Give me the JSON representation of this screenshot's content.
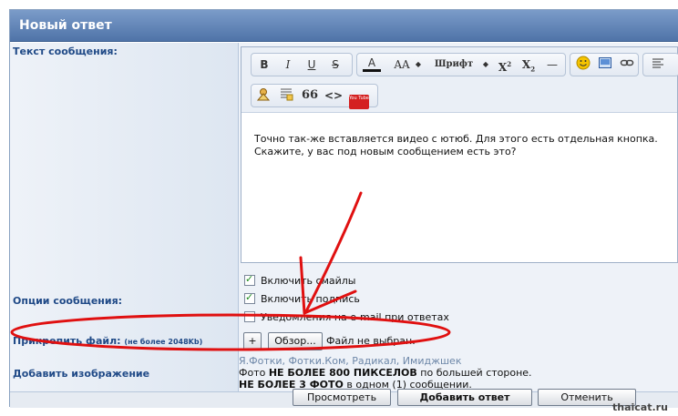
{
  "window": {
    "title": "Новый ответ"
  },
  "labels": {
    "message_text": "Текст сообщения:",
    "message_options": "Опции сообщения:",
    "attach_file": "Прикрепить файл:",
    "attach_limit": "(не более 2048Kb)",
    "add_image": "Добавить изображение"
  },
  "toolbar": {
    "bold": "B",
    "italic": "I",
    "underline": "U",
    "strike": "S",
    "font_color": "A",
    "font_size": "AA",
    "font_name": "Шрифт",
    "superscript": "X",
    "subscript": "X",
    "quote": "66",
    "code": "<>",
    "youtube": "You Tube"
  },
  "message": {
    "line1": "Точно так-же вставляется видео с ютюб. Для этого есть отдельная кнопка.",
    "line2": "Скажите, у вас под новым сообщением есть это?"
  },
  "options": [
    {
      "label": "Включить смайлы",
      "checked": true
    },
    {
      "label": "Включить подпись",
      "checked": true
    },
    {
      "label": "Уведомления на e-mail при ответах",
      "checked": false
    }
  ],
  "attach": {
    "add_button": "+",
    "browse_button": "Обзор...",
    "status": "Файл не выбран."
  },
  "image": {
    "links": "Я.Фотки, Фотки.Ком, Радикал, Имиджшек",
    "line1_pre": "Фото ",
    "line1_bold": "НЕ БОЛЕЕ 800 ПИКСЕЛОВ",
    "line1_post": " по большей стороне.",
    "line2_bold": "НЕ БОЛЕЕ 3 ФОТО",
    "line2_post": " в одном (1) сообщении."
  },
  "buttons": {
    "preview": "Просмотреть",
    "submit": "Добавить ответ",
    "cancel": "Отменить"
  },
  "watermark": "thaicat.ru",
  "colors": {
    "title_bar": "#5a7db3",
    "label_text": "#204a87",
    "annotation": "#e01010"
  }
}
